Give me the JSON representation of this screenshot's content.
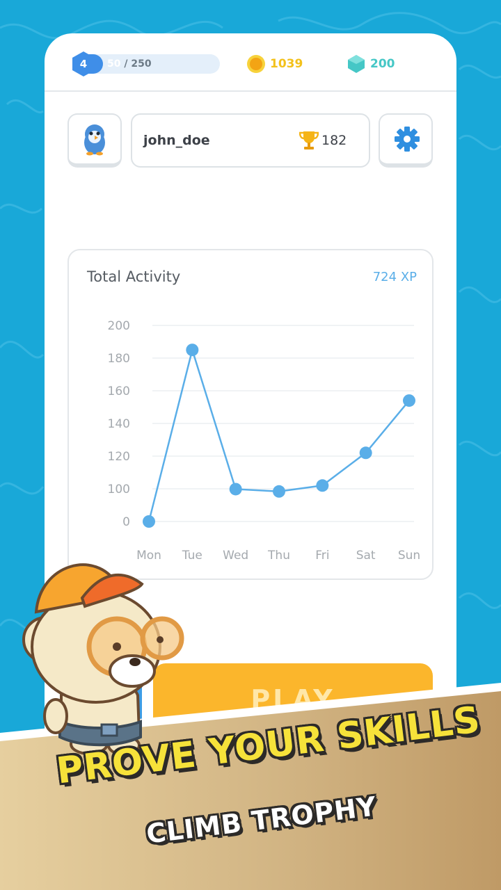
{
  "status": {
    "level": "4",
    "xp_current": "50",
    "xp_max": "/ 250",
    "xp_fraction": 0.2,
    "coins": "1039",
    "gems": "200"
  },
  "profile": {
    "username": "john_doe",
    "trophies": "182"
  },
  "activity": {
    "title": "Total Activity",
    "total_xp": "724 XP"
  },
  "play": {
    "label": "PLAY"
  },
  "banner": {
    "headline": "PROVE YOUR SKILLS",
    "subline": "CLIMB TROPHY"
  },
  "colors": {
    "water": "#19a8d8",
    "xp_bar": "#3f8ee8",
    "coin": "#f3c11b",
    "gem": "#45c7c6",
    "chart_line": "#5aaee8",
    "play_button": "#fbb62c",
    "banner": "#c9a878"
  },
  "chart_data": {
    "type": "line",
    "categories": [
      "Mon",
      "Tue",
      "Wed",
      "Thu",
      "Fri",
      "Sat",
      "Sun"
    ],
    "values": [
      0,
      185,
      99,
      92,
      102,
      122,
      154
    ],
    "y_ticks": [
      "0",
      "100",
      "120",
      "140",
      "160",
      "180",
      "200"
    ],
    "ylim": [
      0,
      200
    ],
    "grid": true,
    "legend": "none"
  }
}
